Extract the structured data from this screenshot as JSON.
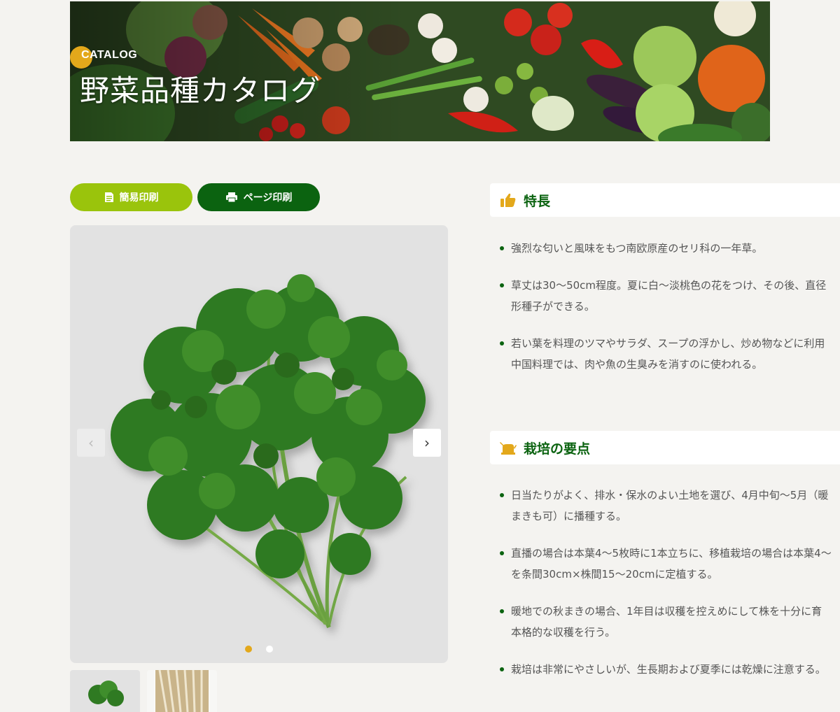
{
  "banner": {
    "eyebrow": "CATALOG",
    "title": "野菜品種カタログ"
  },
  "print": {
    "simple_label": "簡易印刷",
    "page_label": "ページ印刷"
  },
  "viewer": {
    "prev_symbol": "‹",
    "next_symbol": "›",
    "slides_total": 2,
    "active_slide": 1
  },
  "features": {
    "title": "特長",
    "items": [
      {
        "lines": [
          "強烈な匂いと風味をもつ南欧原産のセリ科の一年草。"
        ]
      },
      {
        "lines": [
          "草丈は30～50cm程度。夏に白～淡桃色の花をつけ、その後、直径",
          "形種子ができる。"
        ]
      },
      {
        "lines": [
          "若い葉を料理のツマやサラダ、スープの浮かし、炒め物などに利用",
          "中国料理では、肉や魚の生臭みを消すのに使われる。"
        ]
      }
    ]
  },
  "cultivation": {
    "title": "栽培の要点",
    "items": [
      {
        "lines": [
          "日当たりがよく、排水・保水のよい土地を選び、4月中旬～5月（暖",
          "まきも可）に播種する。"
        ]
      },
      {
        "lines": [
          "直播の場合は本葉4～5枚時に1本立ちに、移植栽培の場合は本葉4～",
          "を条間30cm×株間15～20cmに定植する。"
        ]
      },
      {
        "lines": [
          "暖地での秋まきの場合、1年目は収穫を控えめにして株を十分に育",
          "本格的な収穫を行う。"
        ]
      },
      {
        "lines": [
          "栽培は非常にやさしいが、生長期および夏季には乾燥に注意する。"
        ]
      }
    ]
  },
  "colors": {
    "accent_yellow": "#e3a81b",
    "light_green": "#9ac40c",
    "dark_green": "#0b6310",
    "background": "#f4f3f0"
  },
  "icons": {
    "features": "thumbs-up-icon",
    "cultivation": "watering-can-icon",
    "simple_print": "document-icon",
    "page_print": "printer-icon"
  }
}
